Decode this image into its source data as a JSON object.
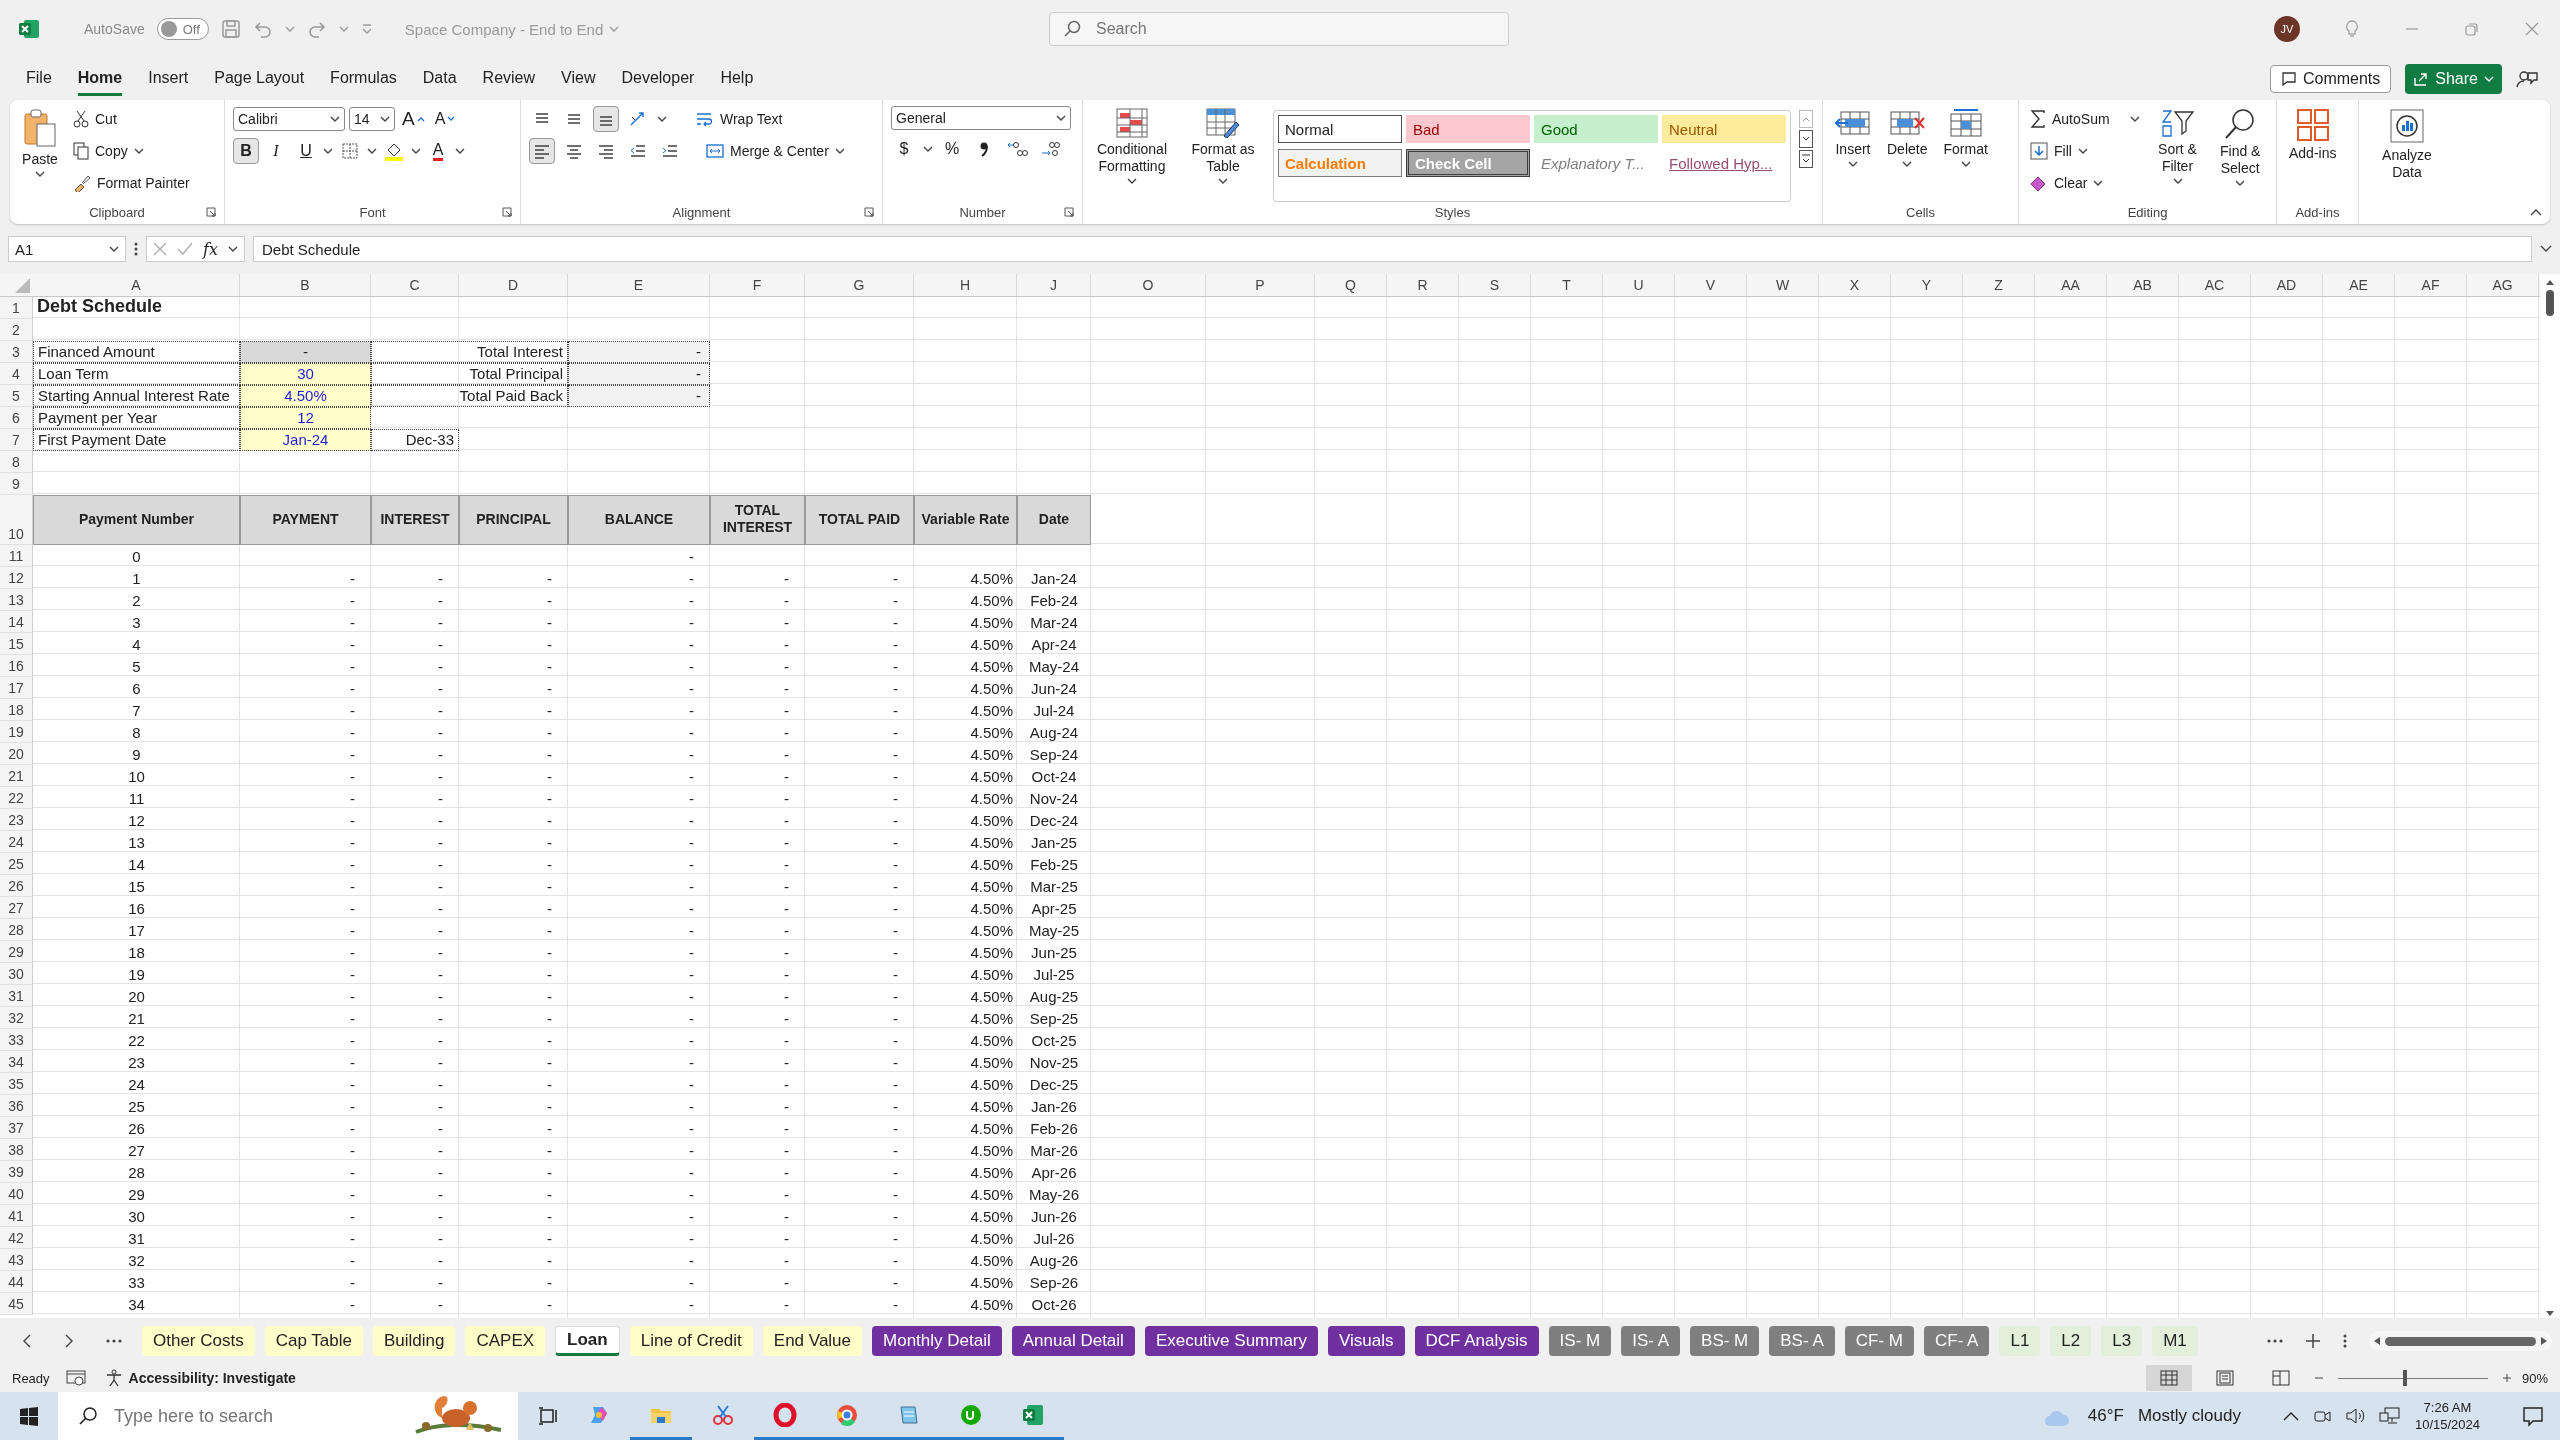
{
  "title_bar": {
    "autosave_label": "AutoSave",
    "autosave": {
      "on": false,
      "label": "Off"
    },
    "document_title": "Space Company - End to End",
    "search_placeholder": "Search",
    "user_initials": "JV"
  },
  "menu_tabs": [
    {
      "label": "File",
      "selected": false
    },
    {
      "label": "Home",
      "selected": true
    },
    {
      "label": "Insert",
      "selected": false
    },
    {
      "label": "Page Layout",
      "selected": false
    },
    {
      "label": "Formulas",
      "selected": false
    },
    {
      "label": "Data",
      "selected": false
    },
    {
      "label": "Review",
      "selected": false
    },
    {
      "label": "View",
      "selected": false
    },
    {
      "label": "Developer",
      "selected": false
    },
    {
      "label": "Help",
      "selected": false
    }
  ],
  "comments_label": "Comments",
  "share_label": "Share",
  "ribbon": [
    {
      "kind": "clipboard",
      "label": "Clipboard",
      "paste": "Paste",
      "cut": "Cut",
      "copy": "Copy",
      "format_painter": "Format Painter"
    },
    {
      "kind": "font",
      "label": "Font",
      "font_name": "Calibri",
      "font_size": "14",
      "grow": "A",
      "shrink": "A",
      "format_buttons": [
        {
          "text": "B",
          "selected": true
        },
        {
          "text": "I",
          "selected": false
        },
        {
          "text": "U",
          "selected": false
        }
      ],
      "font_color": "A"
    },
    {
      "kind": "alignment",
      "label": "Alignment",
      "vertical": [
        {
          "selected": false
        },
        {
          "selected": false
        },
        {
          "selected": true
        }
      ],
      "horizontal": [
        {
          "selected": true
        },
        {
          "selected": false
        },
        {
          "selected": false
        }
      ],
      "wrap_text": "Wrap Text",
      "merge_center": "Merge & Center"
    },
    {
      "kind": "number",
      "label": "Number",
      "format": "General",
      "currency": "$",
      "percent": "%"
    },
    {
      "kind": "styles",
      "label": "Styles",
      "conditional_formatting": "Conditional Formatting",
      "format_as_table": "Format as Table",
      "gallery": [
        {
          "label": "Normal",
          "kind": "normal"
        },
        {
          "label": "Bad",
          "kind": "bad"
        },
        {
          "label": "Good",
          "kind": "good"
        },
        {
          "label": "Neutral",
          "kind": "neutral"
        },
        {
          "label": "Calculation",
          "kind": "calculation"
        },
        {
          "label": "Check Cell",
          "kind": "check"
        },
        {
          "label": "Explanatory T...",
          "kind": "explanatory"
        },
        {
          "label": "Followed Hyp...",
          "kind": "hyperlink"
        }
      ]
    },
    {
      "kind": "cells",
      "label": "Cells",
      "buttons": [
        "Insert",
        "Delete",
        "Format"
      ]
    },
    {
      "kind": "editing",
      "label": "Editing",
      "autosum": "AutoSum",
      "fill": "Fill",
      "clear": "Clear",
      "sort_filter": "Sort & Filter",
      "find_select": "Find & Select"
    },
    {
      "kind": "addins",
      "label": "Add-ins",
      "button": "Add-ins"
    },
    {
      "kind": "analyze",
      "button": "Analyze Data"
    }
  ],
  "formula_bar": {
    "name_box": "A1",
    "fx": "fx",
    "formula": "Debt Schedule"
  },
  "columns": [
    "A",
    "B",
    "C",
    "D",
    "E",
    "F",
    "G",
    "H",
    "J",
    "O",
    "P",
    "Q",
    "R",
    "S",
    "T",
    "U",
    "V",
    "W",
    "X",
    "Y",
    "Z",
    "AA",
    "AB",
    "AC",
    "AD",
    "AE",
    "AF",
    "AG"
  ],
  "rows": [
    {
      "number": "1",
      "cells": {
        "A": {
          "text": "Debt Schedule",
          "kind": "title"
        }
      }
    },
    {
      "number": "2"
    },
    {
      "number": "3",
      "cells": {
        "A": {
          "text": "Financed Amount",
          "kind": "label"
        },
        "B": {
          "text": "-",
          "kind": "computed"
        },
        "C": {
          "text": "Total Interest",
          "kind": "total-label"
        },
        "E": {
          "text": "-",
          "kind": "output"
        }
      }
    },
    {
      "number": "4",
      "cells": {
        "A": {
          "text": "Loan Term",
          "kind": "label"
        },
        "B": {
          "text": "30",
          "kind": "input"
        },
        "C": {
          "text": "Total Principal",
          "kind": "total-label"
        },
        "E": {
          "text": "-",
          "kind": "output"
        }
      }
    },
    {
      "number": "5",
      "cells": {
        "A": {
          "text": "Starting Annual Interest Rate",
          "kind": "label"
        },
        "B": {
          "text": "4.50%",
          "kind": "input"
        },
        "C": {
          "text": "Total Paid Back",
          "kind": "total-label"
        },
        "E": {
          "text": "-",
          "kind": "output"
        }
      }
    },
    {
      "number": "6",
      "cells": {
        "A": {
          "text": "Payment per Year",
          "kind": "label"
        },
        "B": {
          "text": "12",
          "kind": "input"
        }
      }
    },
    {
      "number": "7",
      "cells": {
        "A": {
          "text": "First Payment Date",
          "kind": "label"
        },
        "B": {
          "text": "Jan-24",
          "kind": "input"
        },
        "C": {
          "text": "Dec-33",
          "kind": "date-out"
        }
      }
    },
    {
      "number": "8"
    },
    {
      "number": "9"
    },
    {
      "number": "10",
      "kind": "header",
      "cells": {
        "A": {
          "text": "Payment Number",
          "kind": "header"
        },
        "B": {
          "text": "PAYMENT",
          "kind": "header"
        },
        "C": {
          "text": "INTEREST",
          "kind": "header"
        },
        "D": {
          "text": "PRINCIPAL",
          "kind": "header"
        },
        "E": {
          "text": "BALANCE",
          "kind": "header"
        },
        "F": {
          "text": "TOTAL INTEREST",
          "kind": "header"
        },
        "G": {
          "text": "TOTAL PAID",
          "kind": "header"
        },
        "H": {
          "text": "Variable Rate",
          "kind": "header"
        },
        "J": {
          "text": "Date",
          "kind": "header"
        }
      }
    },
    {
      "number": "11",
      "cells": {
        "A": "0",
        "E": "-"
      }
    },
    {
      "number": "12",
      "cells": {
        "A": "1",
        "B": "-",
        "C": "-",
        "D": "-",
        "E": "-",
        "F": "-",
        "G": "-",
        "H": "4.50%",
        "J": "Jan-24"
      }
    },
    {
      "number": "13",
      "cells": {
        "A": "2",
        "B": "-",
        "C": "-",
        "D": "-",
        "E": "-",
        "F": "-",
        "G": "-",
        "H": "4.50%",
        "J": "Feb-24"
      }
    },
    {
      "number": "14",
      "cells": {
        "A": "3",
        "B": "-",
        "C": "-",
        "D": "-",
        "E": "-",
        "F": "-",
        "G": "-",
        "H": "4.50%",
        "J": "Mar-24"
      }
    },
    {
      "number": "15",
      "cells": {
        "A": "4",
        "B": "-",
        "C": "-",
        "D": "-",
        "E": "-",
        "F": "-",
        "G": "-",
        "H": "4.50%",
        "J": "Apr-24"
      }
    },
    {
      "number": "16",
      "cells": {
        "A": "5",
        "B": "-",
        "C": "-",
        "D": "-",
        "E": "-",
        "F": "-",
        "G": "-",
        "H": "4.50%",
        "J": "May-24"
      }
    },
    {
      "number": "17",
      "cells": {
        "A": "6",
        "B": "-",
        "C": "-",
        "D": "-",
        "E": "-",
        "F": "-",
        "G": "-",
        "H": "4.50%",
        "J": "Jun-24"
      }
    },
    {
      "number": "18",
      "cells": {
        "A": "7",
        "B": "-",
        "C": "-",
        "D": "-",
        "E": "-",
        "F": "-",
        "G": "-",
        "H": "4.50%",
        "J": "Jul-24"
      }
    },
    {
      "number": "19",
      "cells": {
        "A": "8",
        "B": "-",
        "C": "-",
        "D": "-",
        "E": "-",
        "F": "-",
        "G": "-",
        "H": "4.50%",
        "J": "Aug-24"
      }
    },
    {
      "number": "20",
      "cells": {
        "A": "9",
        "B": "-",
        "C": "-",
        "D": "-",
        "E": "-",
        "F": "-",
        "G": "-",
        "H": "4.50%",
        "J": "Sep-24"
      }
    },
    {
      "number": "21",
      "cells": {
        "A": "10",
        "B": "-",
        "C": "-",
        "D": "-",
        "E": "-",
        "F": "-",
        "G": "-",
        "H": "4.50%",
        "J": "Oct-24"
      }
    },
    {
      "number": "22",
      "cells": {
        "A": "11",
        "B": "-",
        "C": "-",
        "D": "-",
        "E": "-",
        "F": "-",
        "G": "-",
        "H": "4.50%",
        "J": "Nov-24"
      }
    },
    {
      "number": "23",
      "cells": {
        "A": "12",
        "B": "-",
        "C": "-",
        "D": "-",
        "E": "-",
        "F": "-",
        "G": "-",
        "H": "4.50%",
        "J": "Dec-24"
      }
    },
    {
      "number": "24",
      "cells": {
        "A": "13",
        "B": "-",
        "C": "-",
        "D": "-",
        "E": "-",
        "F": "-",
        "G": "-",
        "H": "4.50%",
        "J": "Jan-25"
      }
    },
    {
      "number": "25",
      "cells": {
        "A": "14",
        "B": "-",
        "C": "-",
        "D": "-",
        "E": "-",
        "F": "-",
        "G": "-",
        "H": "4.50%",
        "J": "Feb-25"
      }
    },
    {
      "number": "26",
      "cells": {
        "A": "15",
        "B": "-",
        "C": "-",
        "D": "-",
        "E": "-",
        "F": "-",
        "G": "-",
        "H": "4.50%",
        "J": "Mar-25"
      }
    },
    {
      "number": "27",
      "cells": {
        "A": "16",
        "B": "-",
        "C": "-",
        "D": "-",
        "E": "-",
        "F": "-",
        "G": "-",
        "H": "4.50%",
        "J": "Apr-25"
      }
    },
    {
      "number": "28",
      "cells": {
        "A": "17",
        "B": "-",
        "C": "-",
        "D": "-",
        "E": "-",
        "F": "-",
        "G": "-",
        "H": "4.50%",
        "J": "May-25"
      }
    },
    {
      "number": "29",
      "cells": {
        "A": "18",
        "B": "-",
        "C": "-",
        "D": "-",
        "E": "-",
        "F": "-",
        "G": "-",
        "H": "4.50%",
        "J": "Jun-25"
      }
    },
    {
      "number": "30",
      "cells": {
        "A": "19",
        "B": "-",
        "C": "-",
        "D": "-",
        "E": "-",
        "F": "-",
        "G": "-",
        "H": "4.50%",
        "J": "Jul-25"
      }
    },
    {
      "number": "31",
      "cells": {
        "A": "20",
        "B": "-",
        "C": "-",
        "D": "-",
        "E": "-",
        "F": "-",
        "G": "-",
        "H": "4.50%",
        "J": "Aug-25"
      }
    },
    {
      "number": "32",
      "cells": {
        "A": "21",
        "B": "-",
        "C": "-",
        "D": "-",
        "E": "-",
        "F": "-",
        "G": "-",
        "H": "4.50%",
        "J": "Sep-25"
      }
    },
    {
      "number": "33",
      "cells": {
        "A": "22",
        "B": "-",
        "C": "-",
        "D": "-",
        "E": "-",
        "F": "-",
        "G": "-",
        "H": "4.50%",
        "J": "Oct-25"
      }
    },
    {
      "number": "34",
      "cells": {
        "A": "23",
        "B": "-",
        "C": "-",
        "D": "-",
        "E": "-",
        "F": "-",
        "G": "-",
        "H": "4.50%",
        "J": "Nov-25"
      }
    },
    {
      "number": "35",
      "cells": {
        "A": "24",
        "B": "-",
        "C": "-",
        "D": "-",
        "E": "-",
        "F": "-",
        "G": "-",
        "H": "4.50%",
        "J": "Dec-25"
      }
    },
    {
      "number": "36",
      "cells": {
        "A": "25",
        "B": "-",
        "C": "-",
        "D": "-",
        "E": "-",
        "F": "-",
        "G": "-",
        "H": "4.50%",
        "J": "Jan-26"
      }
    },
    {
      "number": "37",
      "cells": {
        "A": "26",
        "B": "-",
        "C": "-",
        "D": "-",
        "E": "-",
        "F": "-",
        "G": "-",
        "H": "4.50%",
        "J": "Feb-26"
      }
    },
    {
      "number": "38",
      "cells": {
        "A": "27",
        "B": "-",
        "C": "-",
        "D": "-",
        "E": "-",
        "F": "-",
        "G": "-",
        "H": "4.50%",
        "J": "Mar-26"
      }
    },
    {
      "number": "39",
      "cells": {
        "A": "28",
        "B": "-",
        "C": "-",
        "D": "-",
        "E": "-",
        "F": "-",
        "G": "-",
        "H": "4.50%",
        "J": "Apr-26"
      }
    },
    {
      "number": "40",
      "cells": {
        "A": "29",
        "B": "-",
        "C": "-",
        "D": "-",
        "E": "-",
        "F": "-",
        "G": "-",
        "H": "4.50%",
        "J": "May-26"
      }
    },
    {
      "number": "41",
      "cells": {
        "A": "30",
        "B": "-",
        "C": "-",
        "D": "-",
        "E": "-",
        "F": "-",
        "G": "-",
        "H": "4.50%",
        "J": "Jun-26"
      }
    },
    {
      "number": "42",
      "cells": {
        "A": "31",
        "B": "-",
        "C": "-",
        "D": "-",
        "E": "-",
        "F": "-",
        "G": "-",
        "H": "4.50%",
        "J": "Jul-26"
      }
    },
    {
      "number": "43",
      "cells": {
        "A": "32",
        "B": "-",
        "C": "-",
        "D": "-",
        "E": "-",
        "F": "-",
        "G": "-",
        "H": "4.50%",
        "J": "Aug-26"
      }
    },
    {
      "number": "44",
      "cells": {
        "A": "33",
        "B": "-",
        "C": "-",
        "D": "-",
        "E": "-",
        "F": "-",
        "G": "-",
        "H": "4.50%",
        "J": "Sep-26"
      }
    },
    {
      "number": "45",
      "cells": {
        "A": "34",
        "B": "-",
        "C": "-",
        "D": "-",
        "E": "-",
        "F": "-",
        "G": "-",
        "H": "4.50%",
        "J": "Oct-26"
      }
    }
  ],
  "sheet_tabs": [
    {
      "label": "Other Costs",
      "color": "#fffdc8",
      "selected": false
    },
    {
      "label": "Cap Table",
      "color": "#fffdc8",
      "selected": false
    },
    {
      "label": "Building",
      "color": "#fffdc8",
      "selected": false
    },
    {
      "label": "CAPEX",
      "color": "#fffdc8",
      "selected": false
    },
    {
      "label": "Loan",
      "selected": true
    },
    {
      "label": "Line of Credit",
      "color": "#fffdc8",
      "selected": false
    },
    {
      "label": "End Value",
      "color": "#fffdc8",
      "selected": false
    },
    {
      "label": "Monthly Detail",
      "color": "#7030a0",
      "selected": false
    },
    {
      "label": "Annual Detail",
      "color": "#7030a0",
      "selected": false
    },
    {
      "label": "Executive Summary",
      "color": "#7030a0",
      "selected": false
    },
    {
      "label": "Visuals",
      "color": "#7030a0",
      "selected": false
    },
    {
      "label": "DCF Analysis",
      "color": "#7030a0",
      "selected": false
    },
    {
      "label": "IS- M",
      "color": "#7f7f7f",
      "selected": false
    },
    {
      "label": "IS- A",
      "color": "#7f7f7f",
      "selected": false
    },
    {
      "label": "BS- M",
      "color": "#7f7f7f",
      "selected": false
    },
    {
      "label": "BS- A",
      "color": "#7f7f7f",
      "selected": false
    },
    {
      "label": "CF- M",
      "color": "#7f7f7f",
      "selected": false
    },
    {
      "label": "CF- A",
      "color": "#7f7f7f",
      "selected": false
    },
    {
      "label": "L1",
      "color": "#e2efda",
      "selected": false
    },
    {
      "label": "L2",
      "color": "#e2efda",
      "selected": false
    },
    {
      "label": "L3",
      "color": "#e2efda",
      "selected": false
    },
    {
      "label": "M1",
      "color": "#e2efda",
      "selected": false
    }
  ],
  "status_bar": {
    "ready": "Ready",
    "accessibility": "Accessibility: Investigate",
    "views": [
      {
        "selected": true
      },
      {
        "selected": false
      },
      {
        "selected": false
      }
    ],
    "zoom": {
      "level": 0.45,
      "label": "90%"
    }
  },
  "taskbar": {
    "search_placeholder": "Type here to search",
    "apps": [
      {
        "open": false
      },
      {
        "open": true
      },
      {
        "open": false
      },
      {
        "open": true
      },
      {
        "open": true
      },
      {
        "open": true
      },
      {
        "open": true
      },
      {
        "open": true
      }
    ],
    "temperature": "46°F",
    "weather": "Mostly cloudy",
    "time": "7:26 AM",
    "date": "10/15/2024"
  }
}
